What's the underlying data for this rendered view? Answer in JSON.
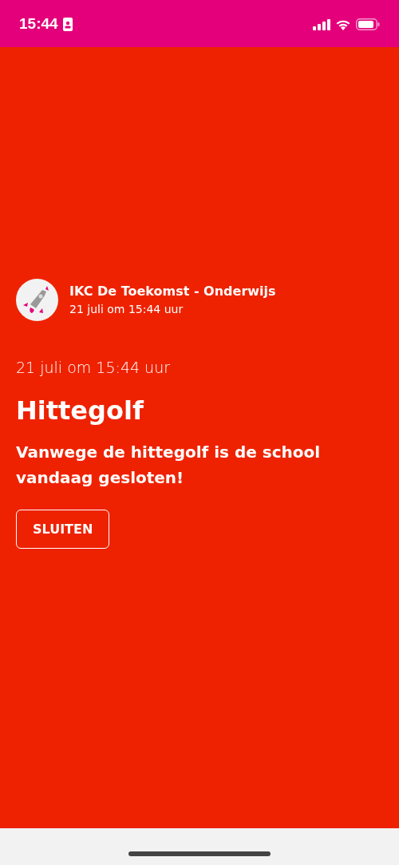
{
  "status_bar": {
    "time": "15:44"
  },
  "sender": {
    "name": "IKC De Toekomst - Onderwijs",
    "time": "21 juli om 15:44 uur"
  },
  "message": {
    "date": "21 juli om 15:44 uur",
    "title": "Hittegolf",
    "body": "Vanwege de hittegolf is de school vandaag gesloten!"
  },
  "buttons": [
    "SLUITEN"
  ]
}
